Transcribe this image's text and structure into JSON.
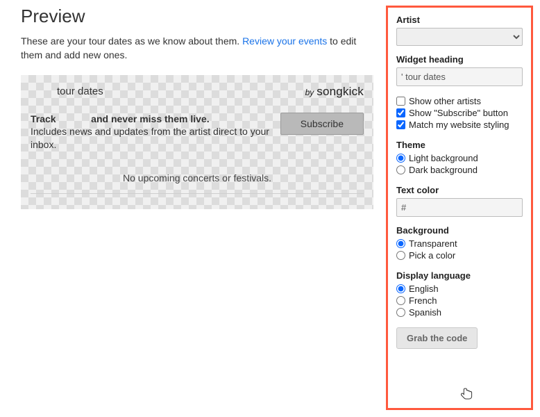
{
  "preview": {
    "title": "Preview",
    "desc_before": "These are your tour dates as we know about them. ",
    "review_link": "Review your events",
    "desc_after": " to edit them and add new ones."
  },
  "widget": {
    "title": "tour dates",
    "by_prefix": "by",
    "brand": "songkick",
    "track_prefix": "Track",
    "track_suffix": "and never miss them live.",
    "track_sub": "Includes news and updates from the artist direct to your inbox.",
    "subscribe": "Subscribe",
    "no_events": "No upcoming concerts or festivals."
  },
  "form": {
    "artist_label": "Artist",
    "artist_value": "",
    "heading_label": "Widget heading",
    "heading_value": "' tour dates",
    "cb_other_artists": "Show other artists",
    "cb_subscribe": "Show \"Subscribe\" button",
    "cb_match": "Match my website styling",
    "theme_label": "Theme",
    "theme_light": "Light background",
    "theme_dark": "Dark background",
    "textcolor_label": "Text color",
    "textcolor_value": "#",
    "bg_label": "Background",
    "bg_transparent": "Transparent",
    "bg_pick": "Pick a color",
    "lang_label": "Display language",
    "lang_en": "English",
    "lang_fr": "French",
    "lang_es": "Spanish",
    "grab": "Grab the code"
  }
}
